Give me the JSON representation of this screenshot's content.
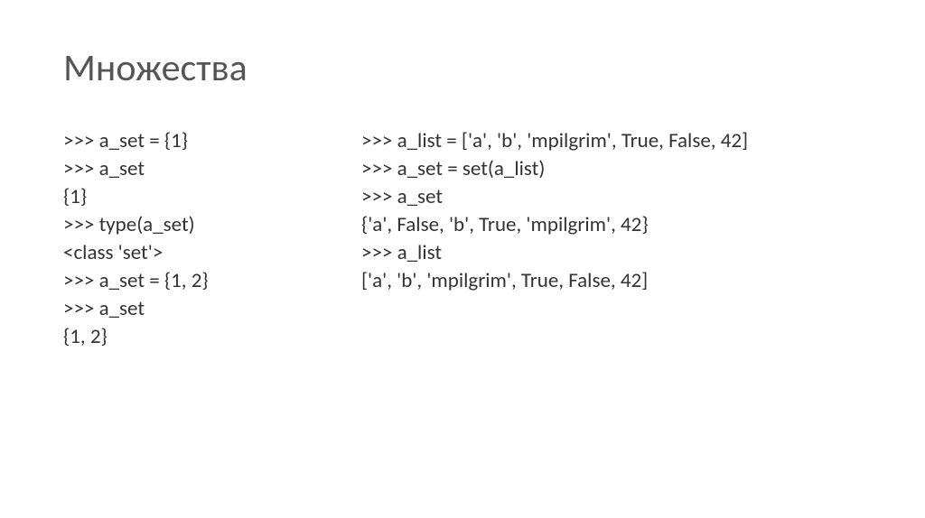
{
  "title": "Множества",
  "leftColumn": {
    "lines": [
      ">>> a_set = {1}",
      ">>> a_set",
      "{1}",
      ">>> type(a_set)",
      "<class 'set'>",
      ">>> a_set = {1, 2}",
      ">>> a_set",
      "{1, 2}"
    ]
  },
  "rightColumn": {
    "lines": [
      ">>> a_list = ['a', 'b', 'mpilgrim', True, False, 42]",
      ">>> a_set = set(a_list)",
      ">>> a_set",
      "{'a', False, 'b', True, 'mpilgrim', 42}",
      ">>> a_list",
      "['a', 'b', 'mpilgrim', True, False, 42]"
    ]
  }
}
